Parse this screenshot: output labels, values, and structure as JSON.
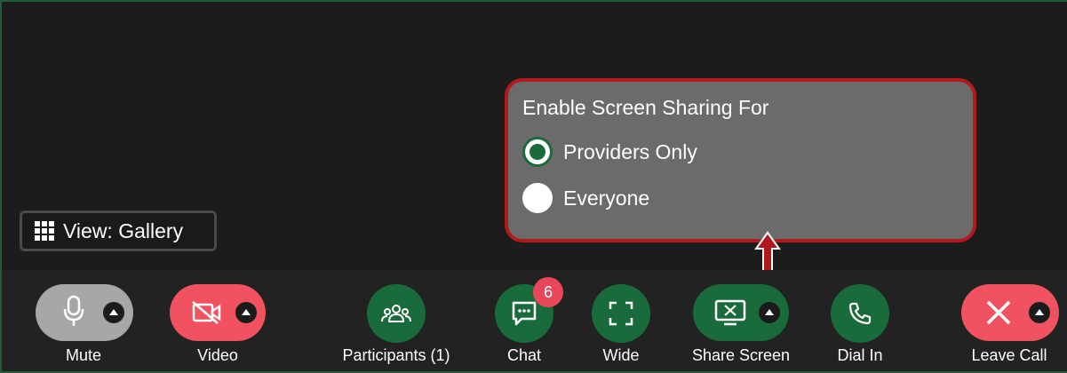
{
  "view_button": {
    "label": "View: Gallery"
  },
  "share_popup": {
    "title": "Enable Screen Sharing For",
    "options": [
      {
        "label": "Providers Only",
        "selected": true
      },
      {
        "label": "Everyone",
        "selected": false
      }
    ]
  },
  "toolbar": {
    "mute": {
      "label": "Mute",
      "icon": "microphone-icon"
    },
    "video": {
      "label": "Video",
      "icon": "video-off-icon"
    },
    "participants": {
      "label": "Participants (1)",
      "icon": "people-icon"
    },
    "chat": {
      "label": "Chat",
      "icon": "chat-icon",
      "badge": "6"
    },
    "wide": {
      "label": "Wide",
      "icon": "expand-icon"
    },
    "share_screen": {
      "label": "Share Screen",
      "icon": "screen-share-icon"
    },
    "dial_in": {
      "label": "Dial In",
      "icon": "phone-icon"
    },
    "leave_call": {
      "label": "Leave Call",
      "icon": "close-icon"
    }
  },
  "colors": {
    "brand_green": "#1a6b3c",
    "danger_red": "#f0535f",
    "mute_gray": "#a7a7a7",
    "highlight_red": "#b3191c"
  }
}
